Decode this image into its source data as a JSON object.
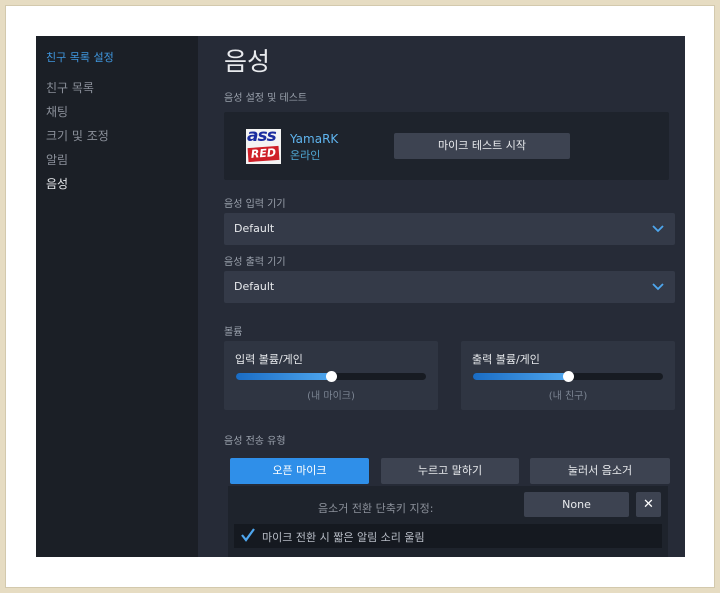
{
  "sidebar": {
    "header": "친구 목록 설정",
    "items": [
      {
        "label": "친구 목록"
      },
      {
        "label": "채팅"
      },
      {
        "label": "크기 및 조정"
      },
      {
        "label": "알림"
      },
      {
        "label": "음성"
      }
    ],
    "active": "음성"
  },
  "main": {
    "title": "음성",
    "voice_test": {
      "section_label": "음성 설정 및 테스트",
      "avatar_text": "ass RED",
      "user_name": "YamaRK",
      "user_status": "온라인",
      "test_button": "마이크 테스트 시작"
    },
    "input_device": {
      "label": "음성 입력 기기",
      "value": "Default",
      "icon": "chevron-down-icon"
    },
    "output_device": {
      "label": "음성 출력 기기",
      "value": "Default",
      "icon": "chevron-down-icon"
    },
    "volume": {
      "label": "볼륨",
      "input": {
        "title": "입력 볼륨/게인",
        "caption": "(내 마이크)",
        "level_percent": 50
      },
      "output": {
        "title": "출력 볼륨/게인",
        "caption": "(내 친구)",
        "level_percent": 50
      }
    },
    "transmission": {
      "label": "음성 전송 유형",
      "modes": [
        "오픈 마이크",
        "누르고 말하기",
        "눌러서 음소거"
      ],
      "selected": "오픈 마이크",
      "hotkey_label": "음소거 전환 단축키 지정:",
      "hotkey_value": "None",
      "clear_icon": "close-icon",
      "checkbox_label": "마이크 전환 시 짧은 알림 소리 울림",
      "checkbox_checked": true
    }
  },
  "colors": {
    "accent": "#2f8fe9",
    "sidebar_bg": "#1b1f26",
    "main_bg": "#262b37",
    "frame": "#e6dcc2"
  }
}
